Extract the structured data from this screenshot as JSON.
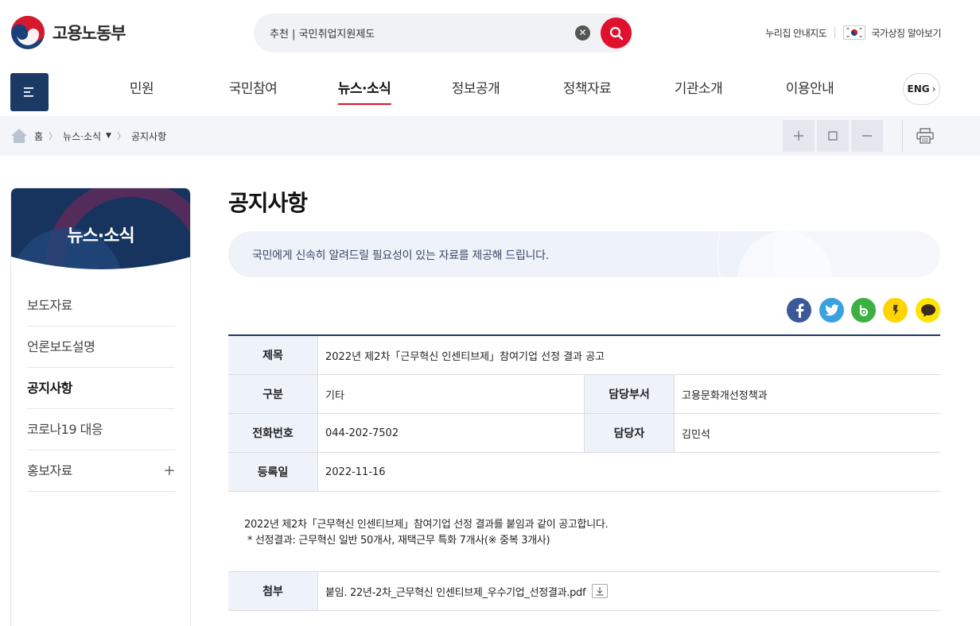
{
  "header": {
    "logo_text": "고용노동부",
    "search": {
      "value": "추천 | 국민취업지원제도",
      "placeholder": ""
    },
    "utility": {
      "sitemap": "누리집 안내지도",
      "national_symbols": "국가상징 알아보기"
    }
  },
  "gnb": {
    "items": [
      {
        "label": "민원",
        "active": false
      },
      {
        "label": "국민참여",
        "active": false
      },
      {
        "label": "뉴스·소식",
        "active": true
      },
      {
        "label": "정보공개",
        "active": false
      },
      {
        "label": "정책자료",
        "active": false
      },
      {
        "label": "기관소개",
        "active": false
      },
      {
        "label": "이용안내",
        "active": false
      }
    ],
    "eng_label": "ENG"
  },
  "breadcrumb": {
    "home": "홈",
    "section": "뉴스·소식",
    "current": "공지사항"
  },
  "lnb": {
    "title": "뉴스·소식",
    "items": [
      {
        "label": "보도자료"
      },
      {
        "label": "언론보도설명"
      },
      {
        "label": "공지사항",
        "active": true
      },
      {
        "label": "코로나19 대응"
      },
      {
        "label": "홍보자료",
        "expandable": true
      }
    ]
  },
  "content": {
    "title": "공지사항",
    "intro": "국민에게 신속히 알려드릴 필요성이 있는 자료를 제공해 드립니다.",
    "sns_icons": [
      "facebook-icon",
      "twitter-icon",
      "band-icon",
      "kakaostory-icon",
      "kakaotalk-icon"
    ],
    "table": {
      "subject_label": "제목",
      "subject": "2022년 제2차「근무혁신 인센티브제」참여기업 선정 결과 공고",
      "category_label": "구분",
      "category": "기타",
      "dept_label": "담당부서",
      "dept": "고용문화개선정책과",
      "phone_label": "전화번호",
      "phone": "044-202-7502",
      "manager_label": "담당자",
      "manager": "김민석",
      "date_label": "등록일",
      "date": "2022-11-16"
    },
    "body_lines": [
      "2022년 제2차「근무혁신 인센티브제」참여기업 선정 결과를 붙임과 같이 공고합니다.",
      " * 선정결과: 근무혁신 일반 50개사, 재택근무 특화 7개사(※ 중복 3개사)"
    ],
    "attachment": {
      "label": "첨부",
      "filename": "붙임. 22년-2차_근무혁신 인센티브제_우수기업_선정결과.pdf"
    }
  },
  "colors": {
    "navy": "#1a3a63",
    "red": "#e0112c",
    "light_bg": "#eef2f9"
  }
}
